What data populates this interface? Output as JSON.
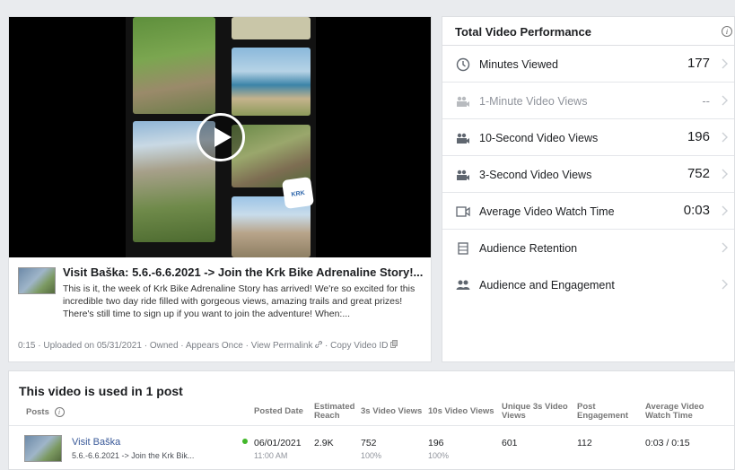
{
  "video": {
    "post_title": "Visit Baška: 5.6.-6.6.2021 -> Join the Krk Bike Adrenaline Story!...",
    "post_text": "This is it, the week of Krk Bike Adrenaline Story has arrived! We're so excited for this incredible two day ride filled with gorgeous views, amazing trails and great prizes! There's still time to sign up if you want to join the adventure! When:...",
    "meta": {
      "duration": "0:15",
      "uploaded": "Uploaded on 05/31/2021",
      "owned": "Owned",
      "appears": "Appears Once",
      "permalink": "View Permalink",
      "copy_id": "Copy Video ID",
      "sep": "·"
    }
  },
  "performance": {
    "title": "Total Video Performance",
    "info_glyph": "i",
    "rows": [
      {
        "label": "Minutes Viewed",
        "value": "177",
        "icon": "clock-icon"
      },
      {
        "label": "1-Minute Video Views",
        "value": "--",
        "icon": "video-views-icon"
      },
      {
        "label": "10-Second Video Views",
        "value": "196",
        "icon": "video-views-icon"
      },
      {
        "label": "3-Second Video Views",
        "value": "752",
        "icon": "video-views-icon"
      },
      {
        "label": "Average Video Watch Time",
        "value": "0:03",
        "icon": "video-camera-icon"
      },
      {
        "label": "Audience Retention",
        "value": "",
        "icon": "film-icon"
      },
      {
        "label": "Audience and Engagement",
        "value": "",
        "icon": "people-icon"
      }
    ]
  },
  "posts_table": {
    "title": "This video is used in 1 post",
    "headers": {
      "posts": "Posts",
      "posted_date": "Posted Date",
      "estimated_reach_1": "Estimated",
      "estimated_reach_2": "Reach",
      "views_3s": "3s Video Views",
      "views_10s": "10s Video Views",
      "unique_1": "Unique 3s Video",
      "unique_2": "Views",
      "engagement_1": "Post",
      "engagement_2": "Engagement",
      "avg_watch_1": "Average Video",
      "avg_watch_2": "Watch Time"
    },
    "row": {
      "name": "Visit Baška",
      "desc": "5.6.-6.6.2021 -> Join the Krk Bik...",
      "date": "06/01/2021",
      "time": "11:00 AM",
      "reach": "2.9K",
      "views_3s": "752",
      "views_3s_pct": "100%",
      "views_10s": "196",
      "views_10s_pct": "100%",
      "unique": "601",
      "engagement": "112",
      "avg_watch": "0:03 / 0:15"
    }
  }
}
